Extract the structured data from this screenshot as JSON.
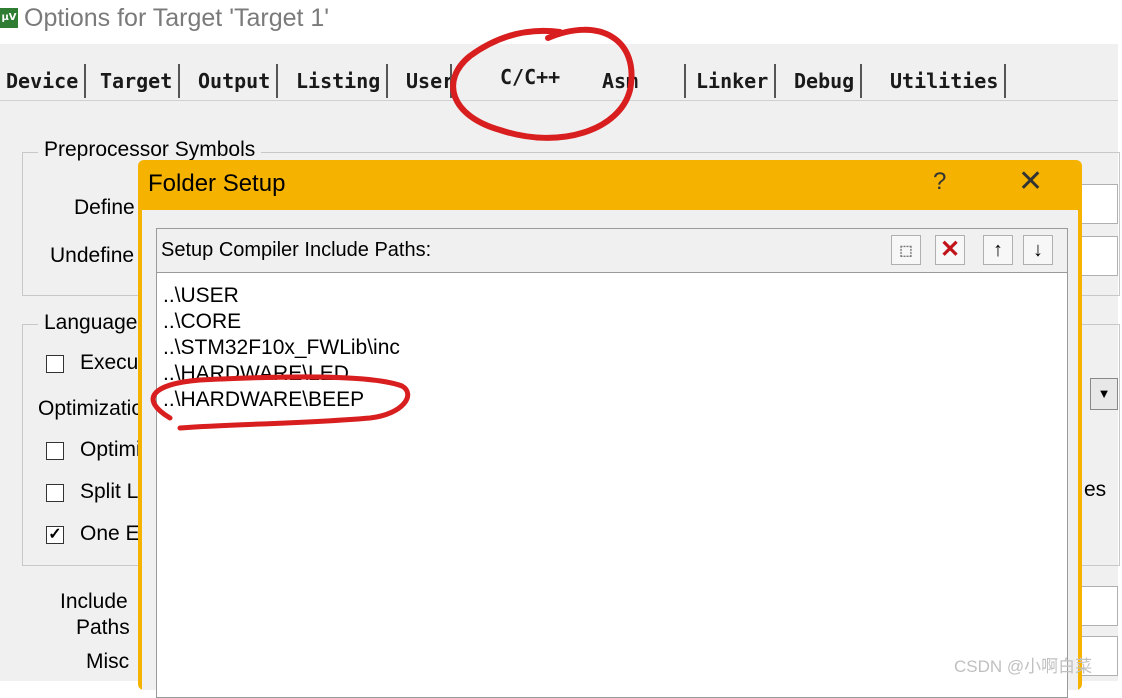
{
  "window": {
    "title": "Options for Target 'Target 1'",
    "icon": "keil-uvision-icon"
  },
  "tabs": [
    {
      "label": "Device"
    },
    {
      "label": "Target"
    },
    {
      "label": "Output"
    },
    {
      "label": "Listing"
    },
    {
      "label": "User"
    },
    {
      "label": "C/C++",
      "active": true
    },
    {
      "label": "Asm"
    },
    {
      "label": "Linker"
    },
    {
      "label": "Debug"
    },
    {
      "label": "Utilities"
    }
  ],
  "background": {
    "preprocessor_caption": "Preprocessor Symbols",
    "define_label": "Define",
    "undefine_label": "Undefine",
    "language_caption": "Language",
    "execute_only_label": "Execu",
    "optimization_label": "Optimizatio",
    "optimize_label": "Optimi",
    "split_label": "Split L",
    "one_elf_label": "One E",
    "include_paths_label": "Include Paths",
    "include_paths_line1": "Include",
    "include_paths_line2": "Paths",
    "misc_label": "Misc",
    "right_clip_text": "es",
    "checkboxes": {
      "execute_only": false,
      "optimize": false,
      "split": false,
      "one_elf": true
    }
  },
  "dialog": {
    "title": "Folder Setup",
    "help": "?",
    "close": "✕",
    "list_label": "Setup Compiler Include Paths:",
    "paths": [
      "..\\USER",
      "..\\CORE",
      "..\\STM32F10x_FWLib\\inc",
      "..\\HARDWARE\\LED",
      "..\\HARDWARE\\BEEP"
    ],
    "toolbar_icons": [
      "new-folder-icon",
      "delete-icon",
      "move-up-icon",
      "move-down-icon"
    ]
  },
  "annotation_color": "#d81e1e",
  "accent_color": "#f5b300",
  "watermark": "CSDN @小啊白菜"
}
